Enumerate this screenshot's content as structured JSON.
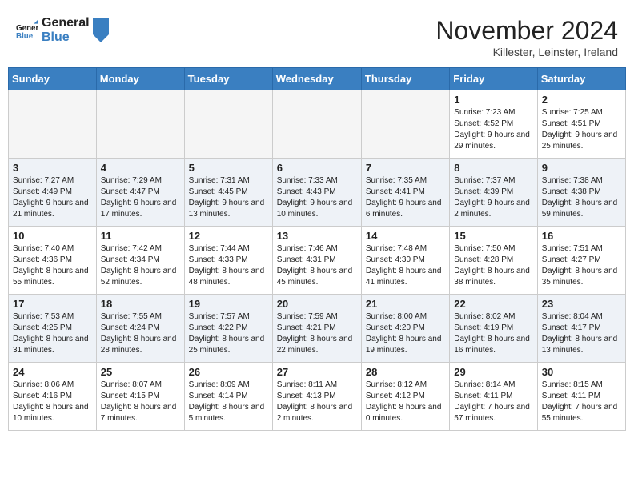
{
  "logo": {
    "line1": "General",
    "line2": "Blue"
  },
  "title": "November 2024",
  "location": "Killester, Leinster, Ireland",
  "days_of_week": [
    "Sunday",
    "Monday",
    "Tuesday",
    "Wednesday",
    "Thursday",
    "Friday",
    "Saturday"
  ],
  "weeks": [
    [
      {
        "day": null
      },
      {
        "day": null
      },
      {
        "day": null
      },
      {
        "day": null
      },
      {
        "day": null
      },
      {
        "day": "1",
        "sunrise": "7:23 AM",
        "sunset": "4:52 PM",
        "daylight": "9 hours and 29 minutes."
      },
      {
        "day": "2",
        "sunrise": "7:25 AM",
        "sunset": "4:51 PM",
        "daylight": "9 hours and 25 minutes."
      }
    ],
    [
      {
        "day": "3",
        "sunrise": "7:27 AM",
        "sunset": "4:49 PM",
        "daylight": "9 hours and 21 minutes."
      },
      {
        "day": "4",
        "sunrise": "7:29 AM",
        "sunset": "4:47 PM",
        "daylight": "9 hours and 17 minutes."
      },
      {
        "day": "5",
        "sunrise": "7:31 AM",
        "sunset": "4:45 PM",
        "daylight": "9 hours and 13 minutes."
      },
      {
        "day": "6",
        "sunrise": "7:33 AM",
        "sunset": "4:43 PM",
        "daylight": "9 hours and 10 minutes."
      },
      {
        "day": "7",
        "sunrise": "7:35 AM",
        "sunset": "4:41 PM",
        "daylight": "9 hours and 6 minutes."
      },
      {
        "day": "8",
        "sunrise": "7:37 AM",
        "sunset": "4:39 PM",
        "daylight": "9 hours and 2 minutes."
      },
      {
        "day": "9",
        "sunrise": "7:38 AM",
        "sunset": "4:38 PM",
        "daylight": "8 hours and 59 minutes."
      }
    ],
    [
      {
        "day": "10",
        "sunrise": "7:40 AM",
        "sunset": "4:36 PM",
        "daylight": "8 hours and 55 minutes."
      },
      {
        "day": "11",
        "sunrise": "7:42 AM",
        "sunset": "4:34 PM",
        "daylight": "8 hours and 52 minutes."
      },
      {
        "day": "12",
        "sunrise": "7:44 AM",
        "sunset": "4:33 PM",
        "daylight": "8 hours and 48 minutes."
      },
      {
        "day": "13",
        "sunrise": "7:46 AM",
        "sunset": "4:31 PM",
        "daylight": "8 hours and 45 minutes."
      },
      {
        "day": "14",
        "sunrise": "7:48 AM",
        "sunset": "4:30 PM",
        "daylight": "8 hours and 41 minutes."
      },
      {
        "day": "15",
        "sunrise": "7:50 AM",
        "sunset": "4:28 PM",
        "daylight": "8 hours and 38 minutes."
      },
      {
        "day": "16",
        "sunrise": "7:51 AM",
        "sunset": "4:27 PM",
        "daylight": "8 hours and 35 minutes."
      }
    ],
    [
      {
        "day": "17",
        "sunrise": "7:53 AM",
        "sunset": "4:25 PM",
        "daylight": "8 hours and 31 minutes."
      },
      {
        "day": "18",
        "sunrise": "7:55 AM",
        "sunset": "4:24 PM",
        "daylight": "8 hours and 28 minutes."
      },
      {
        "day": "19",
        "sunrise": "7:57 AM",
        "sunset": "4:22 PM",
        "daylight": "8 hours and 25 minutes."
      },
      {
        "day": "20",
        "sunrise": "7:59 AM",
        "sunset": "4:21 PM",
        "daylight": "8 hours and 22 minutes."
      },
      {
        "day": "21",
        "sunrise": "8:00 AM",
        "sunset": "4:20 PM",
        "daylight": "8 hours and 19 minutes."
      },
      {
        "day": "22",
        "sunrise": "8:02 AM",
        "sunset": "4:19 PM",
        "daylight": "8 hours and 16 minutes."
      },
      {
        "day": "23",
        "sunrise": "8:04 AM",
        "sunset": "4:17 PM",
        "daylight": "8 hours and 13 minutes."
      }
    ],
    [
      {
        "day": "24",
        "sunrise": "8:06 AM",
        "sunset": "4:16 PM",
        "daylight": "8 hours and 10 minutes."
      },
      {
        "day": "25",
        "sunrise": "8:07 AM",
        "sunset": "4:15 PM",
        "daylight": "8 hours and 7 minutes."
      },
      {
        "day": "26",
        "sunrise": "8:09 AM",
        "sunset": "4:14 PM",
        "daylight": "8 hours and 5 minutes."
      },
      {
        "day": "27",
        "sunrise": "8:11 AM",
        "sunset": "4:13 PM",
        "daylight": "8 hours and 2 minutes."
      },
      {
        "day": "28",
        "sunrise": "8:12 AM",
        "sunset": "4:12 PM",
        "daylight": "8 hours and 0 minutes."
      },
      {
        "day": "29",
        "sunrise": "8:14 AM",
        "sunset": "4:11 PM",
        "daylight": "7 hours and 57 minutes."
      },
      {
        "day": "30",
        "sunrise": "8:15 AM",
        "sunset": "4:11 PM",
        "daylight": "7 hours and 55 minutes."
      }
    ]
  ]
}
